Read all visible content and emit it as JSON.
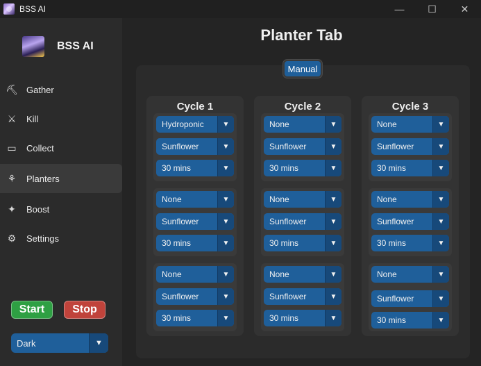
{
  "window": {
    "title": "BSS AI",
    "controls": {
      "minimize": "—",
      "maximize": "☐",
      "close": "✕"
    }
  },
  "sidebar": {
    "brand": "BSS AI",
    "items": [
      {
        "label": "Gather",
        "icon": "shovel-icon",
        "glyph": "⛏"
      },
      {
        "label": "Kill",
        "icon": "sword-icon",
        "glyph": "⚔"
      },
      {
        "label": "Collect",
        "icon": "ticket-icon",
        "glyph": "▭"
      },
      {
        "label": "Planters",
        "icon": "planter-icon",
        "glyph": "⚘"
      },
      {
        "label": "Boost",
        "icon": "boost-icon",
        "glyph": "✦"
      },
      {
        "label": "Settings",
        "icon": "gear-icon",
        "glyph": "⚙"
      }
    ],
    "active_item": "Planters",
    "start_label": "Start",
    "stop_label": "Stop",
    "theme": "Dark"
  },
  "main": {
    "title": "Planter Tab",
    "mode_button": "Manual",
    "cycles": [
      {
        "title": "Cycle 1",
        "groups": [
          [
            "Hydroponic",
            "Sunflower",
            "30 mins"
          ],
          [
            "None",
            "Sunflower",
            "30 mins"
          ],
          [
            "None",
            "Sunflower",
            "30 mins"
          ]
        ]
      },
      {
        "title": "Cycle 2",
        "groups": [
          [
            "None",
            "Sunflower",
            "30 mins"
          ],
          [
            "None",
            "Sunflower",
            "30 mins"
          ],
          [
            "None",
            "Sunflower",
            "30 mins"
          ]
        ]
      },
      {
        "title": "Cycle 3",
        "groups": [
          [
            "None",
            "Sunflower",
            "30 mins"
          ],
          [
            "None",
            "Sunflower",
            "30 mins"
          ],
          [
            "None",
            "Sunflower",
            "30 mins"
          ]
        ]
      }
    ]
  },
  "colors": {
    "accent": "#1f5f9a",
    "start": "#2ea043",
    "stop": "#c0433b"
  }
}
